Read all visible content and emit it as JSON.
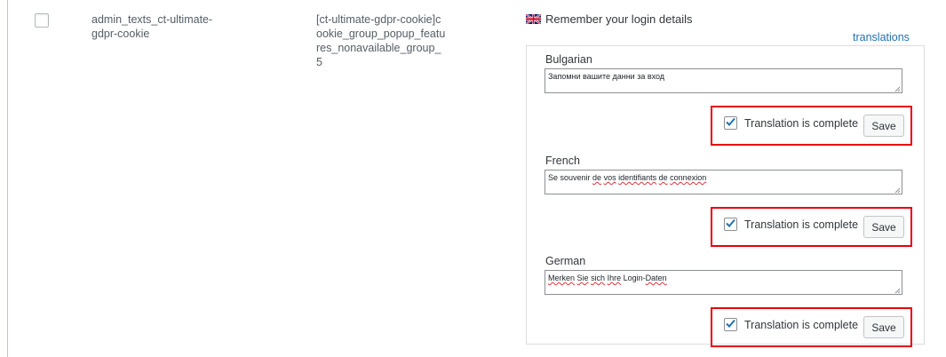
{
  "row": {
    "name": "admin_texts_ct-ultimate-gdpr-cookie",
    "context": "[ct-ultimate-gdpr-cookie]cookie_group_popup_features_nonavailable_group_5",
    "original": "Remember your login details",
    "original_flag": "uk-flag-icon",
    "translations_link": "translations"
  },
  "translations": [
    {
      "language": "Bulgarian",
      "text_parts": [
        {
          "text": "Запомни вашите данни за вход",
          "misspelled": false
        }
      ],
      "complete_label": "Translation is complete",
      "complete_checked": true,
      "save_label": "Save"
    },
    {
      "language": "French",
      "text_parts": [
        {
          "text": "Se souvenir ",
          "misspelled": false
        },
        {
          "text": "de",
          "misspelled": true
        },
        {
          "text": " ",
          "misspelled": false
        },
        {
          "text": "vos",
          "misspelled": true
        },
        {
          "text": " ",
          "misspelled": false
        },
        {
          "text": "identifiants",
          "misspelled": true
        },
        {
          "text": " ",
          "misspelled": false
        },
        {
          "text": "de",
          "misspelled": true
        },
        {
          "text": " ",
          "misspelled": false
        },
        {
          "text": "connexion",
          "misspelled": true
        }
      ],
      "complete_label": "Translation is complete",
      "complete_checked": true,
      "save_label": "Save"
    },
    {
      "language": "German",
      "text_parts": [
        {
          "text": "Merken",
          "misspelled": true
        },
        {
          "text": " ",
          "misspelled": false
        },
        {
          "text": "Sie",
          "misspelled": true
        },
        {
          "text": " ",
          "misspelled": false
        },
        {
          "text": "sich",
          "misspelled": true
        },
        {
          "text": " ",
          "misspelled": false
        },
        {
          "text": "Ihre",
          "misspelled": true
        },
        {
          "text": " Login-",
          "misspelled": false
        },
        {
          "text": "Daten",
          "misspelled": true
        }
      ],
      "complete_label": "Translation is complete",
      "complete_checked": true,
      "save_label": "Save"
    }
  ],
  "colors": {
    "highlight_border": "#e8000b",
    "link": "#2271b1",
    "checkbox_check": "#2271b1"
  }
}
